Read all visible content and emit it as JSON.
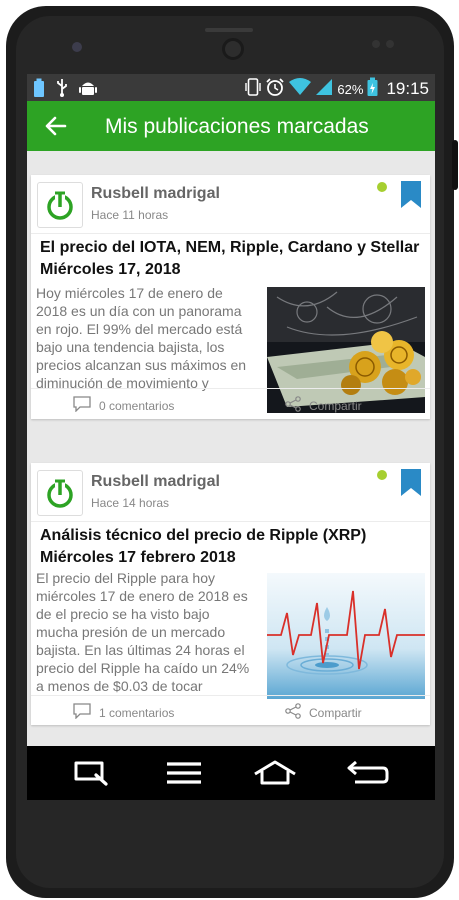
{
  "status_bar": {
    "battery_percent": "62%",
    "time": "19:15",
    "icons_left": [
      "battery-saver-icon",
      "usb-icon",
      "android-icon"
    ],
    "icons_right": [
      "vibrate-icon",
      "alarm-icon",
      "wifi-icon",
      "signal-icon",
      "battery-charging-icon"
    ]
  },
  "app_bar": {
    "title": "Mis publicaciones marcadas",
    "back_icon": "arrow-back-icon",
    "color": "#2da324"
  },
  "posts": [
    {
      "author": "Rusbell madrigal",
      "time": "Hace 11 horas",
      "title": "El precio del IOTA, NEM, Ripple, Cardano y Stellar Miércoles 17, 2018",
      "excerpt": "Hoy miércoles 17 de enero de 2018 es un día con un panorama en rojo. El 99% del mercado está bajo una tendencia bajista, los precios alcanzan sus máximos en diminución de movimiento y",
      "image": "crypto-coins-dollar-image",
      "comments": "0 comentarios",
      "share": "Compartir",
      "bookmarked": true
    },
    {
      "author": "Rusbell madrigal",
      "time": "Hace 14 horas",
      "title": "Análisis técnico del precio de Ripple (XRP) Miércoles 17 febrero 2018",
      "excerpt": "El precio del Ripple para hoy miércoles 17 de enero de 2018 es de el precio se ha visto bajo mucha presión de un mercado bajista. En las últimas 24 horas el precio del Ripple ha caído un 24% a menos de $0.03 de tocar",
      "image": "water-drop-heartbeat-image",
      "comments": "1 comentarios",
      "share": "Compartir",
      "bookmarked": true
    }
  ],
  "colors": {
    "accent_green": "#2da324",
    "bookmark_blue": "#2a8ac6",
    "online_dot": "#a6cf30"
  },
  "nav_bar": {
    "icons": [
      "search-nav-icon",
      "menu-nav-icon",
      "home-nav-icon",
      "back-nav-icon"
    ]
  }
}
